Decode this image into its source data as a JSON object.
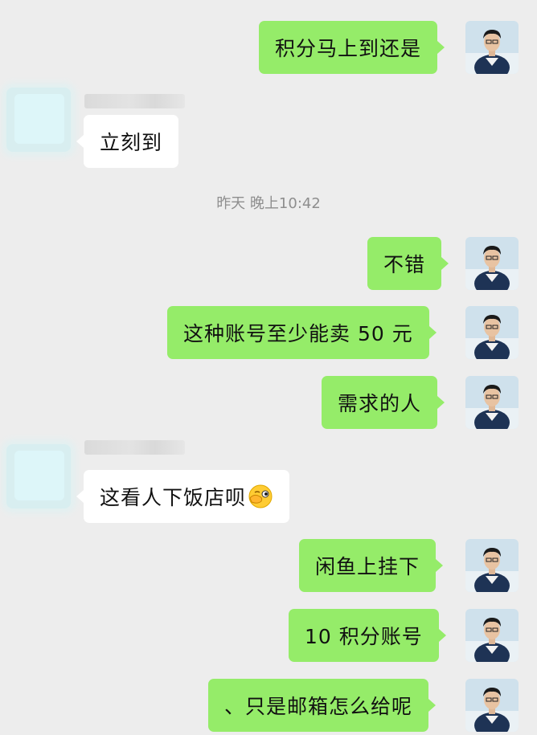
{
  "timestamp": "昨天 晚上10:42",
  "messages": {
    "m1": "积分马上到还是",
    "m2": "立刻到",
    "m3": "不错",
    "m4": "这种账号至少能卖 50 元",
    "m5": "需求的人",
    "m6": "这看人下饭店呗",
    "m7": "闲鱼上挂下",
    "m8": "10 积分账号",
    "m9": "、只是邮箱怎么给呢"
  },
  "emoji": {
    "m6": "face-with-hand-over-mouth-emoji"
  },
  "colors": {
    "background": "#ededed",
    "self_bubble": "#95ec69",
    "other_bubble": "#ffffff",
    "timestamp": "#8e8e8e"
  }
}
